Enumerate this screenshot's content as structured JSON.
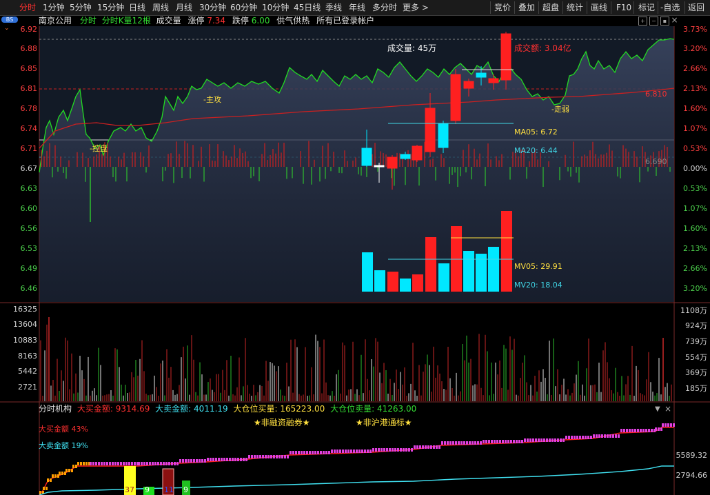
{
  "tabs": [
    "分时",
    "1分钟",
    "5分钟",
    "15分钟",
    "日线",
    "周线",
    "月线",
    "30分钟",
    "60分钟",
    "10分钟",
    "45日线",
    "季线",
    "年线",
    "多分时",
    "更多 >"
  ],
  "active_tab": "分时",
  "right_tabs": [
    "竞价",
    "叠加",
    "超盘",
    "统计",
    "画线",
    "F10",
    "标记",
    "-自选",
    "返回"
  ],
  "bs_badge": "BS",
  "title": {
    "stock": "南京公用",
    "mode": "分时",
    "kline": "分时K量12根",
    "vol_label": "成交量",
    "limit_up_label": "涨停",
    "limit_up": "7.34",
    "limit_down_label": "跌停",
    "limit_down": "6.00",
    "gongqi": "供气供热",
    "accounts": "所有已登录帐户"
  },
  "price_axis": [
    "6.92",
    "6.88",
    "6.85",
    "6.81",
    "6.78",
    "6.74",
    "6.71",
    "6.67",
    "6.63",
    "6.60",
    "6.56",
    "6.53",
    "6.49",
    "6.46"
  ],
  "pct_axis": [
    "3.73%",
    "3.20%",
    "2.66%",
    "2.13%",
    "1.60%",
    "1.07%",
    "0.53%",
    "0.00%",
    "0.53%",
    "1.07%",
    "1.60%",
    "2.13%",
    "2.66%",
    "3.20%"
  ],
  "annotations": {
    "volume": "成交量: 45万",
    "amount": "成交额: 3.04亿",
    "ma05": "MA05: 6.72",
    "ma20": "MA20: 6.44",
    "mv05": "MV05: 29.91",
    "mv20": "MV20: 18.04",
    "zhugong": "主攻",
    "tiaokong": "控盘",
    "zoubi": "走弱",
    "avg_price": "6.810",
    "prev_close": "6.690"
  },
  "volume_axis_left": [
    "16325",
    "13604",
    "10883",
    "8163",
    "5442",
    "2721"
  ],
  "volume_axis_right": [
    "1108万",
    "924万",
    "739万",
    "554万",
    "369万",
    "185万"
  ],
  "bottom_panel": {
    "name": "分时机构",
    "big_buy_label": "大买金额:",
    "big_buy": "9314.69",
    "big_sell_label": "大卖金额:",
    "big_sell": "4011.19",
    "pos_buy_label": "大仓位买量:",
    "pos_buy": "165223.00",
    "pos_sell_label": "大仓位卖量:",
    "pos_sell": "41263.00",
    "tag1": "★非融资融券★",
    "tag2": "★非沪港通标★",
    "buy_pct_label": "大买金额",
    "buy_pct": "43%",
    "sell_pct_label": "大卖金额",
    "sell_pct": "19%",
    "axis_top": "5589.32",
    "axis_bottom": "2794.66",
    "bar_labels": [
      "37",
      "9",
      "11",
      "9"
    ]
  },
  "colors": {
    "up": "#ff2020",
    "down": "#00ffff",
    "price_line": "#22dd22",
    "avg_line": "#dd2020",
    "bg": "#000000"
  }
}
